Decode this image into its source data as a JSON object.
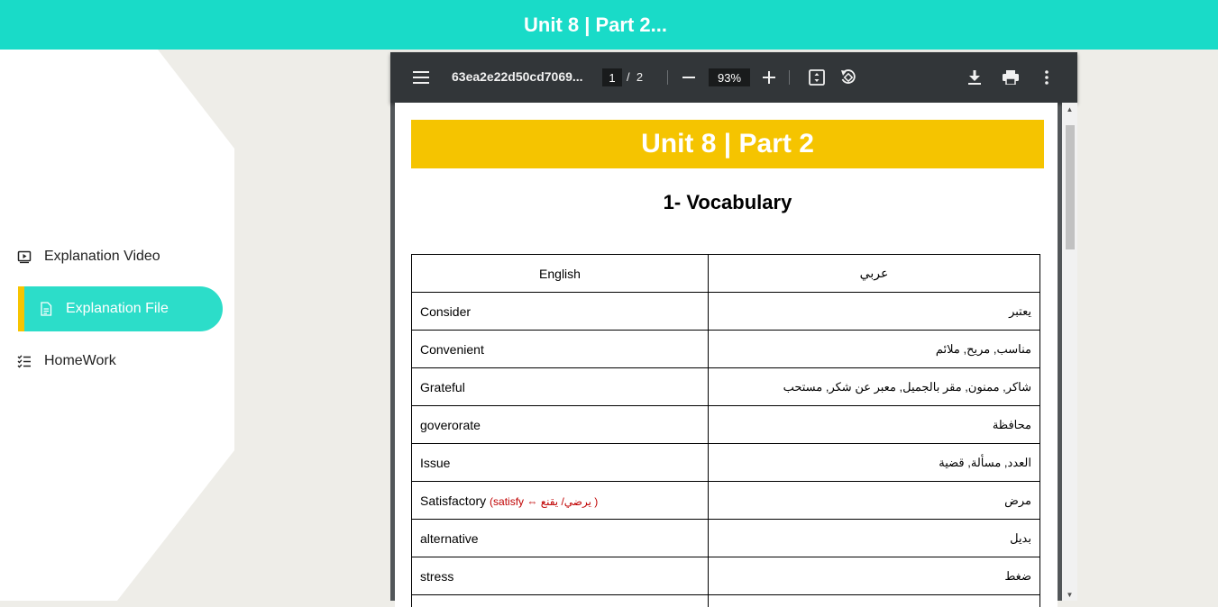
{
  "header": {
    "title": "Unit 8 | Part 2..."
  },
  "sidebar": {
    "items": [
      {
        "label": "Explanation Video",
        "icon": "play-video-icon",
        "active": false
      },
      {
        "label": "Explanation File",
        "icon": "file-icon",
        "active": true
      },
      {
        "label": "HomeWork",
        "icon": "checklist-icon",
        "active": false
      }
    ]
  },
  "viewer": {
    "filename": "63ea2e22d50cd7069...",
    "current_page": "1",
    "page_separator": "/",
    "total_pages": "2",
    "zoom": "93%"
  },
  "document": {
    "banner": "Unit 8 | Part 2",
    "heading": "1- Vocabulary",
    "table": {
      "headers": [
        "English",
        "عربي"
      ],
      "rows": [
        {
          "en": "Consider",
          "ar": "يعتبر"
        },
        {
          "en": "Convenient",
          "ar": "مناسب, مريح, ملائم"
        },
        {
          "en": "Grateful",
          "ar": "شاكر, ممنون, مقر بالجميل, معبر عن شكر, مستحب"
        },
        {
          "en": "goverorate",
          "ar": "محافظة"
        },
        {
          "en": "Issue",
          "ar": "العدد, مسألة, قضية"
        },
        {
          "en": "Satisfactory",
          "note": "(satisfy ⇔ يرضي/ يقنع )",
          "ar": "مرض"
        },
        {
          "en": "alternative",
          "ar": "بديل"
        },
        {
          "en": "stress",
          "ar": "ضغط"
        },
        {
          "en": "",
          "ar": ""
        }
      ]
    }
  },
  "colors": {
    "header_bg": "#19dbc8",
    "active_item_bg": "#2cddc9",
    "active_accent": "#f7c400",
    "banner_bg": "#f5c400",
    "toolbar_bg": "#323639",
    "note_text": "#c00000"
  }
}
